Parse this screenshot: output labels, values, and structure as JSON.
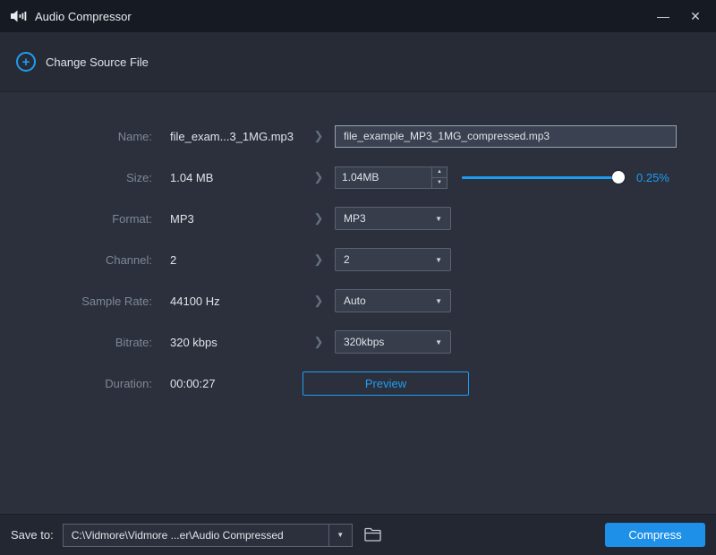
{
  "window": {
    "title": "Audio Compressor"
  },
  "icons": {
    "minimize": "—",
    "close": "✕",
    "chevron": "❯",
    "caret": "▼",
    "spin_up": "▲",
    "spin_down": "▼",
    "plus": "+"
  },
  "header": {
    "change_source_label": "Change Source File"
  },
  "rows": {
    "name": {
      "label": "Name:",
      "current": "file_exam...3_1MG.mp3",
      "output": "file_example_MP3_1MG_compressed.mp3"
    },
    "size": {
      "label": "Size:",
      "current": "1.04 MB",
      "target": "1.04MB",
      "percent": "0.25%"
    },
    "format": {
      "label": "Format:",
      "current": "MP3",
      "selected": "MP3"
    },
    "channel": {
      "label": "Channel:",
      "current": "2",
      "selected": "2"
    },
    "sample_rate": {
      "label": "Sample Rate:",
      "current": "44100 Hz",
      "selected": "Auto"
    },
    "bitrate": {
      "label": "Bitrate:",
      "current": "320 kbps",
      "selected": "320kbps"
    },
    "duration": {
      "label": "Duration:",
      "current": "00:00:27",
      "preview_label": "Preview"
    }
  },
  "footer": {
    "save_to_label": "Save to:",
    "path": "C:\\Vidmore\\Vidmore ...er\\Audio Compressed",
    "compress_label": "Compress"
  }
}
